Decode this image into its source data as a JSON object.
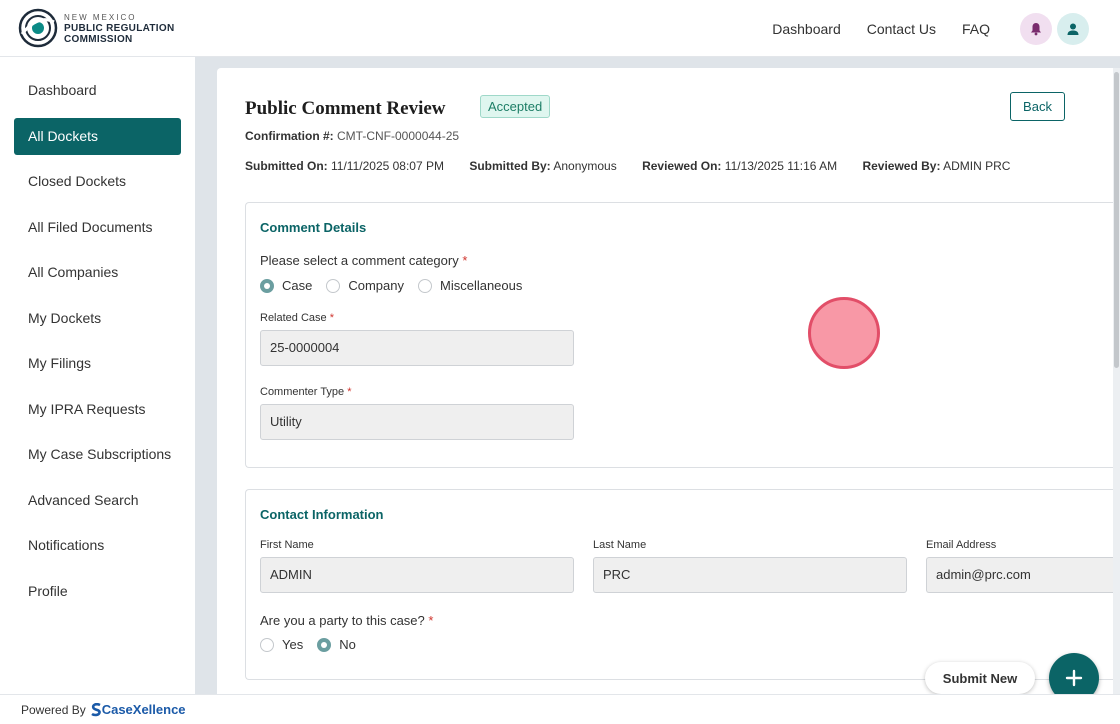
{
  "header": {
    "logo_small": "NEW MEXICO",
    "logo_line1": "PUBLIC REGULATION",
    "logo_line2": "COMMISSION",
    "nav": [
      "Dashboard",
      "Contact Us",
      "FAQ"
    ],
    "icons": [
      "bell-icon",
      "user-icon"
    ]
  },
  "sidebar": {
    "items": [
      {
        "label": "Dashboard"
      },
      {
        "label": "All Dockets",
        "active": true
      },
      {
        "label": "Closed Dockets"
      },
      {
        "label": "All Filed Documents"
      },
      {
        "label": "All Companies"
      },
      {
        "label": "My Dockets"
      },
      {
        "label": "My Filings"
      },
      {
        "label": "My IPRA Requests"
      },
      {
        "label": "My Case Subscriptions"
      },
      {
        "label": "Advanced Search"
      },
      {
        "label": "Notifications"
      },
      {
        "label": "Profile"
      }
    ]
  },
  "page": {
    "title": "Public Comment Review",
    "status": "Accepted",
    "back_label": "Back",
    "confirmation_label": "Confirmation #:",
    "confirmation_value": "CMT-CNF-0000044-25",
    "meta": {
      "submitted_on_label": "Submitted On:",
      "submitted_on": "11/11/2025 08:07 PM",
      "submitted_by_label": "Submitted By:",
      "submitted_by": "Anonymous",
      "reviewed_on_label": "Reviewed On:",
      "reviewed_on": "11/13/2025 11:16 AM",
      "reviewed_by_label": "Reviewed By:",
      "reviewed_by": "ADMIN PRC"
    }
  },
  "comment_details": {
    "title": "Comment Details",
    "category_label": "Please select a comment category",
    "required_mark": "*",
    "options": [
      "Case",
      "Company",
      "Miscellaneous"
    ],
    "selected": "Case",
    "related_case_label": "Related Case",
    "related_case_value": "25-0000004",
    "commenter_type_label": "Commenter Type",
    "commenter_type_value": "Utility"
  },
  "contact": {
    "title": "Contact Information",
    "first_name_label": "First Name",
    "first_name": "ADMIN",
    "last_name_label": "Last Name",
    "last_name": "PRC",
    "email_label": "Email Address",
    "email": "admin@prc.com",
    "party_label": "Are you a party to this case?",
    "party_options": [
      "Yes",
      "No"
    ],
    "party_selected": "No"
  },
  "actions": {
    "submit_new": "Submit New",
    "fab_icon": "plus-icon"
  },
  "footer": {
    "powered_by": "Powered By",
    "brand": "CaseXellence"
  },
  "colors": {
    "primary": "#0b6466",
    "accent_badge": "#dff6ef",
    "required": "#d0352e"
  }
}
